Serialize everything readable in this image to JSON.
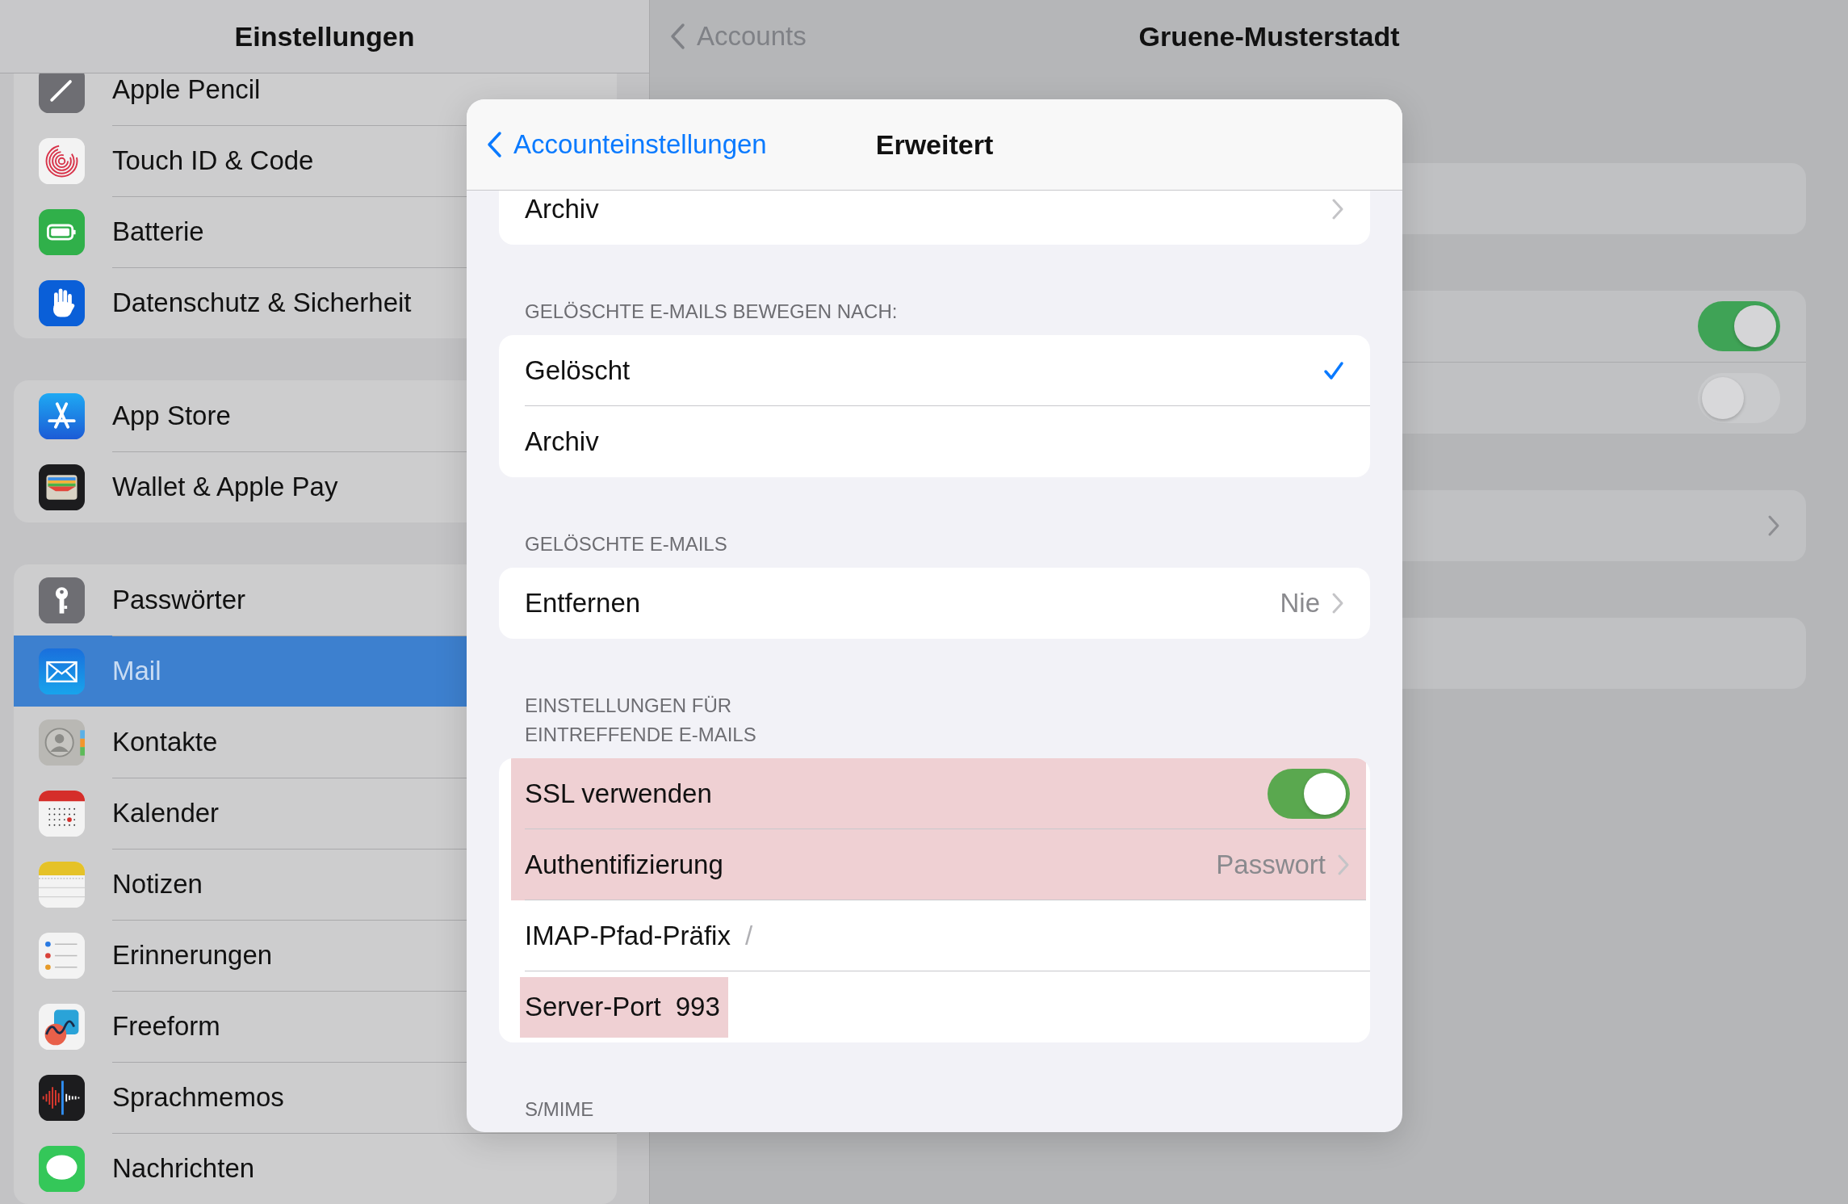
{
  "sidebar": {
    "title": "Einstellungen",
    "groups": [
      {
        "items": [
          {
            "label": "Apple Pencil",
            "selected": false
          },
          {
            "label": "Touch ID & Code",
            "selected": false
          },
          {
            "label": "Batterie",
            "selected": false
          },
          {
            "label": "Datenschutz & Sicherheit",
            "selected": false
          }
        ]
      },
      {
        "items": [
          {
            "label": "App Store",
            "selected": false
          },
          {
            "label": "Wallet & Apple Pay",
            "selected": false
          }
        ]
      },
      {
        "items": [
          {
            "label": "Passwörter",
            "selected": false
          },
          {
            "label": "Mail",
            "selected": true
          },
          {
            "label": "Kontakte",
            "selected": false
          },
          {
            "label": "Kalender",
            "selected": false
          },
          {
            "label": "Notizen",
            "selected": false
          },
          {
            "label": "Erinnerungen",
            "selected": false
          },
          {
            "label": "Freeform",
            "selected": false
          },
          {
            "label": "Sprachmemos",
            "selected": false
          },
          {
            "label": "Nachrichten",
            "selected": false
          }
        ]
      }
    ]
  },
  "detail": {
    "back": "Accounts",
    "title": "Gruene-Musterstadt",
    "toggles": [
      {
        "on": true
      },
      {
        "on": false
      }
    ]
  },
  "sheet": {
    "back": "Accounteinstellungen",
    "title": "Erweitert",
    "sections": [
      {
        "rows": [
          {
            "kind": "link",
            "label": "Archiv",
            "highlighted": false
          }
        ]
      },
      {
        "header": [
          "GELÖSCHTE E-MAILS BEWEGEN NACH:"
        ],
        "rows": [
          {
            "kind": "choice",
            "label": "Gelöscht",
            "selected": true,
            "highlighted": false
          },
          {
            "kind": "choice",
            "label": "Archiv",
            "selected": false,
            "highlighted": false
          }
        ]
      },
      {
        "header": [
          "GELÖSCHTE E-MAILS"
        ],
        "rows": [
          {
            "kind": "link",
            "label": "Entfernen",
            "value": "Nie",
            "highlighted": false
          }
        ]
      },
      {
        "header": [
          "EINSTELLUNGEN FÜR",
          "EINTREFFENDE E-MAILS"
        ],
        "rows": [
          {
            "kind": "toggle",
            "label": "SSL verwenden",
            "on": true,
            "highlighted": true
          },
          {
            "kind": "link",
            "label": "Authentifizierung",
            "value": "Passwort",
            "highlighted": true
          },
          {
            "kind": "field",
            "label": "IMAP-Pfad-Präfix",
            "placeholder": "/",
            "highlighted": false
          },
          {
            "kind": "field",
            "label": "Server-Port",
            "value": "993",
            "highlighted": true
          }
        ]
      },
      {
        "header": [
          "S/MIME"
        ]
      }
    ]
  }
}
